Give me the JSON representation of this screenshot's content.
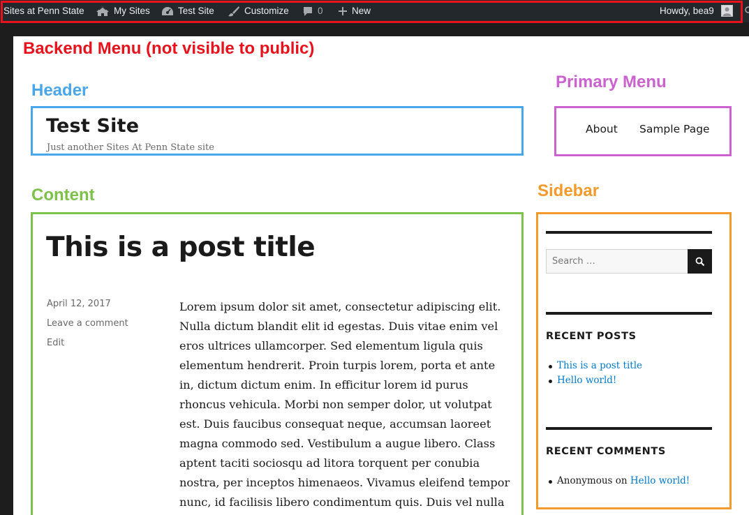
{
  "admin_bar": {
    "network": "Sites at Penn State",
    "my_sites": "My Sites",
    "site": "Test Site",
    "customize": "Customize",
    "comments_count": "0",
    "new": "New",
    "howdy": "Howdy, bea9"
  },
  "annotations": {
    "backend": "Backend Menu (not visible to public)",
    "header": "Header",
    "primary_menu": "Primary Menu",
    "content": "Content",
    "sidebar": "Sidebar"
  },
  "colors": {
    "backend": "#e8121c",
    "header": "#4aa6ea",
    "primary_menu": "#cb62cf",
    "content": "#7cc14a",
    "sidebar": "#f39a2b",
    "link": "#007acc"
  },
  "site": {
    "title": "Test Site",
    "description": "Just another Sites At Penn State site"
  },
  "menu": {
    "items": [
      "About",
      "Sample Page"
    ]
  },
  "post": {
    "title": "This is a post title",
    "date": "April 12, 2017",
    "comment_link": "Leave a comment",
    "edit_link": "Edit",
    "body": "Lorem ipsum dolor sit amet, consectetur adipiscing elit. Nulla dictum blandit elit id egestas. Duis vitae enim vel eros ultrices ullamcorper. Sed elementum ligula quis elementum hendrerit. Proin turpis lorem, porta et ante in, dictum dictum enim. In efficitur lorem id purus rhoncus vehicula. Morbi non semper dolor, ut volutpat est. Duis faucibus consequat neque, accumsan laoreet magna commodo sed. Vestibulum a augue libero. Class aptent taciti sociosqu ad litora torquent per conubia nostra, per inceptos himenaeos. Vivamus eleifend tempor nunc, id facilisis libero condimentum quis. Duis vel nulla lobortis,"
  },
  "sidebar": {
    "search_placeholder": "Search …",
    "recent_posts_title": "RECENT POSTS",
    "recent_posts": [
      "This is a post title",
      "Hello world!"
    ],
    "recent_comments_title": "RECENT COMMENTS",
    "recent_comment": {
      "author": "Anonymous",
      "on": "on",
      "post": "Hello world!"
    }
  },
  "icons": {
    "my_sites": "my-sites-icon",
    "site": "dashboard-icon",
    "customize": "brush-icon",
    "comments": "comment-bubble-icon",
    "new": "plus-icon",
    "search": "search-icon",
    "avatar": "avatar-icon"
  }
}
